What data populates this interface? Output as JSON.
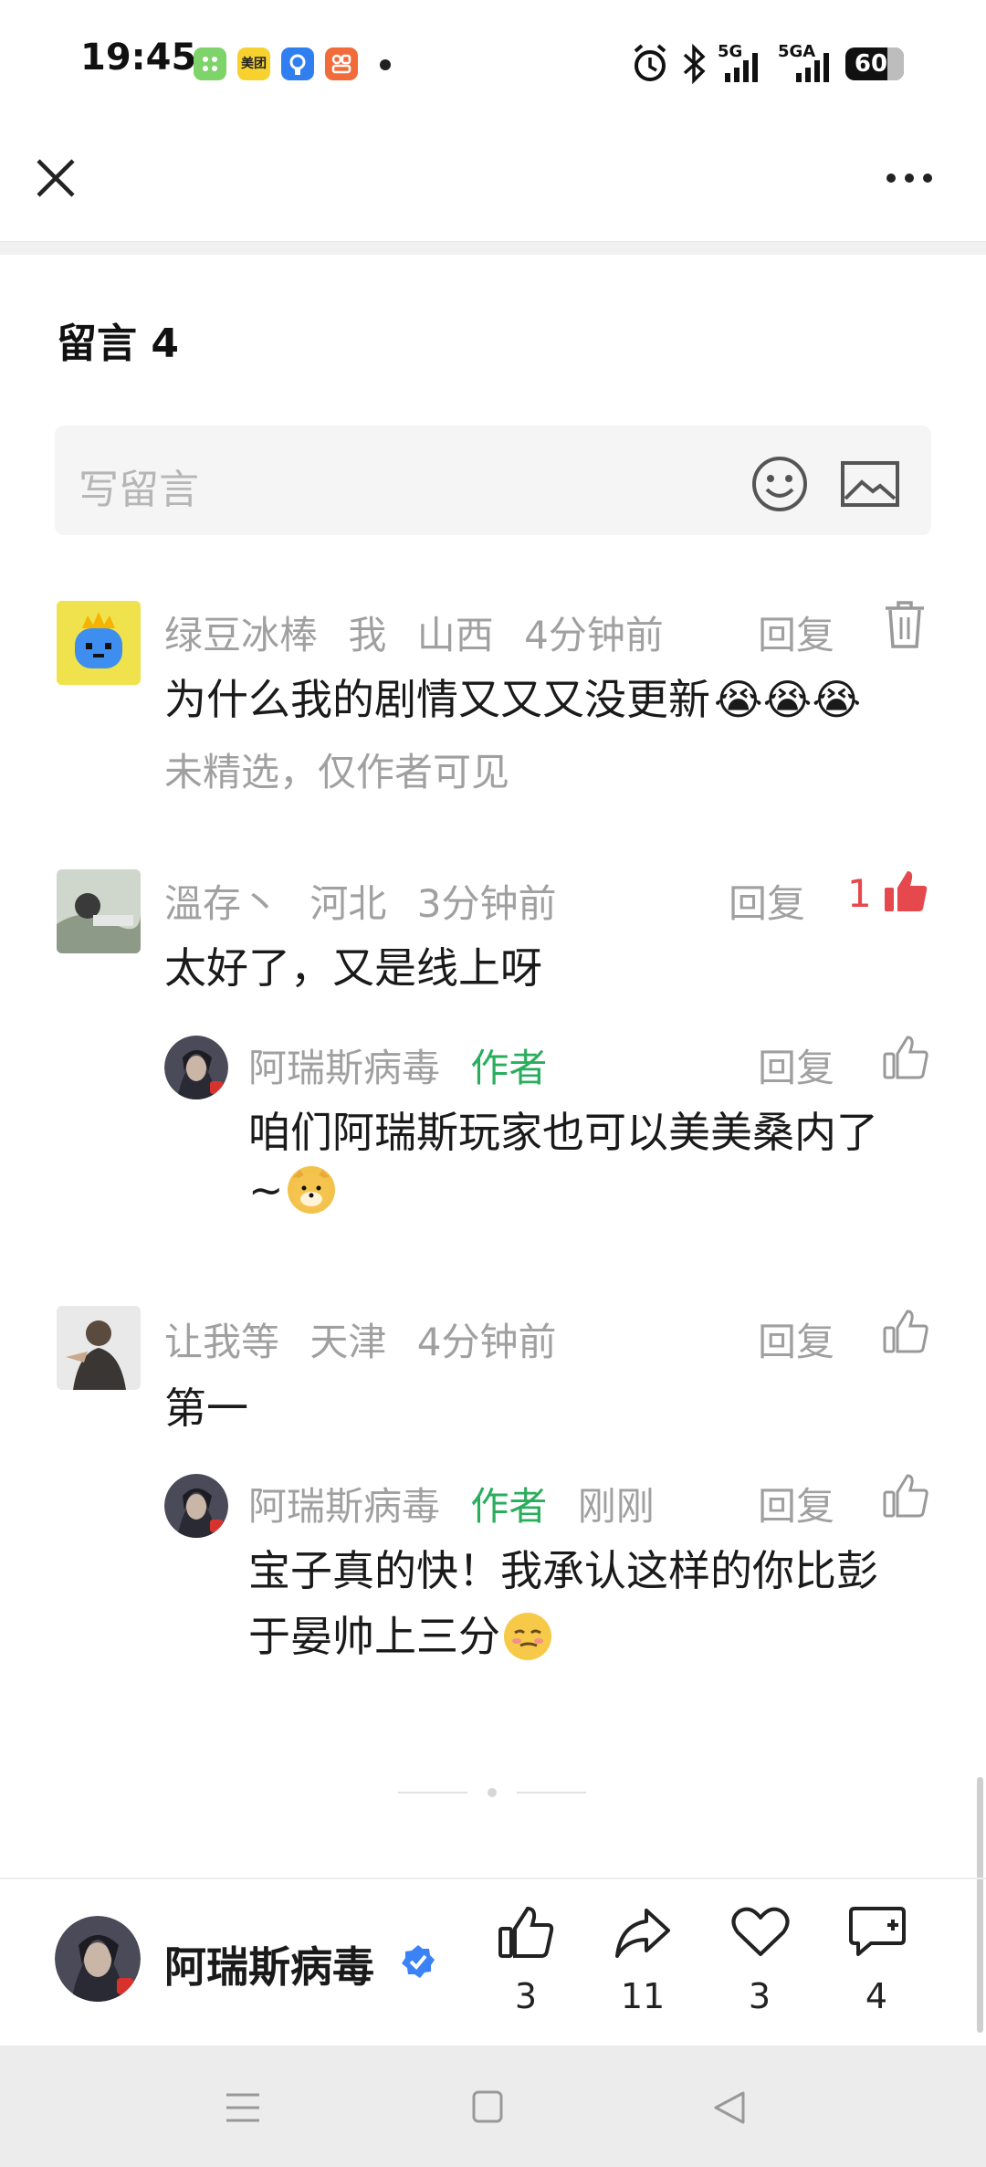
{
  "status_bar": {
    "time": "19:45",
    "app_icons": [
      "app-green-icon",
      "meituan-icon",
      "app-blue-icon",
      "app-orange-icon"
    ],
    "meituan_label": "美团",
    "network_5g": "5G",
    "network_5ga": "5GA",
    "battery": "60"
  },
  "header": {
    "close_icon": "close-icon",
    "more_icon": "more-icon"
  },
  "comments_section": {
    "title": "留言 4",
    "input_placeholder": "写留言",
    "emoji_icon": "smile-icon",
    "image_icon": "image-icon"
  },
  "comments": [
    {
      "name": "绿豆冰棒",
      "me": "我",
      "region": "山西",
      "time": "4分钟前",
      "reply_label": "回复",
      "text": "为什么我的剧情又又又没更新",
      "emoji": "😭😭😭",
      "note": "未精选，仅作者可见"
    },
    {
      "name": "溫存丶",
      "region": "河北",
      "time": "3分钟前",
      "reply_label": "回复",
      "likes": "1",
      "text": "太好了，又是线上呀",
      "reply": {
        "name": "阿瑞斯病毒",
        "tag": "作者",
        "reply_label": "回复",
        "text_line1": "咱们阿瑞斯玩家也可以美美桑内了",
        "text_line2": "~",
        "emoji": "🐶"
      }
    },
    {
      "name": "让我等",
      "region": "天津",
      "time": "4分钟前",
      "reply_label": "回复",
      "text": "第一",
      "reply": {
        "name": "阿瑞斯病毒",
        "tag": "作者",
        "time": "刚刚",
        "reply_label": "回复",
        "text_line1": "宝子真的快！我承认这样的你比彭",
        "text_line2": "于晏帅上三分",
        "emoji": "😒"
      }
    }
  ],
  "footer": {
    "account_name": "阿瑞斯病毒",
    "like_count": "3",
    "share_count": "11",
    "favorite_count": "3",
    "comment_count": "4"
  },
  "colors": {
    "author_green": "#2aad5d",
    "like_red": "#e5484d",
    "meta_gray": "#a0a0a0",
    "verified_blue": "#3b82f6"
  }
}
